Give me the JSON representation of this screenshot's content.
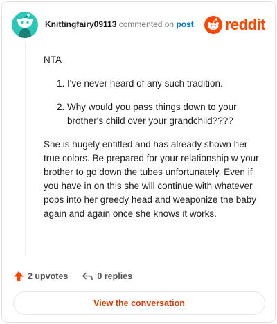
{
  "header": {
    "username": "Knittingfairy09113",
    "verb": "commented on",
    "link_text": "post",
    "brand": "reddit"
  },
  "comment": {
    "intro": "NTA",
    "list": [
      "I've never heard of any such tradition.",
      "Why would you pass things down to your brother's child over your grandchild????"
    ],
    "paragraph": "She is hugely entitled and has already shown her true colors. Be prepared for your relationship w your brother to go down the tubes unfortunately. Even if you have in on this she will continue with whatever pops into her greedy head and weaponize the baby again and again once she knows it works."
  },
  "actions": {
    "upvotes": "2 upvotes",
    "replies": "0 replies"
  },
  "cta": {
    "label": "View the conversation"
  },
  "colors": {
    "accent": "#ff4500",
    "link": "#0079d3",
    "avatar_bg": "#29c8b8"
  },
  "icons": [
    "avatar-snoo-icon",
    "reddit-logo-icon",
    "upvote-arrow-icon",
    "reply-arrow-icon"
  ]
}
